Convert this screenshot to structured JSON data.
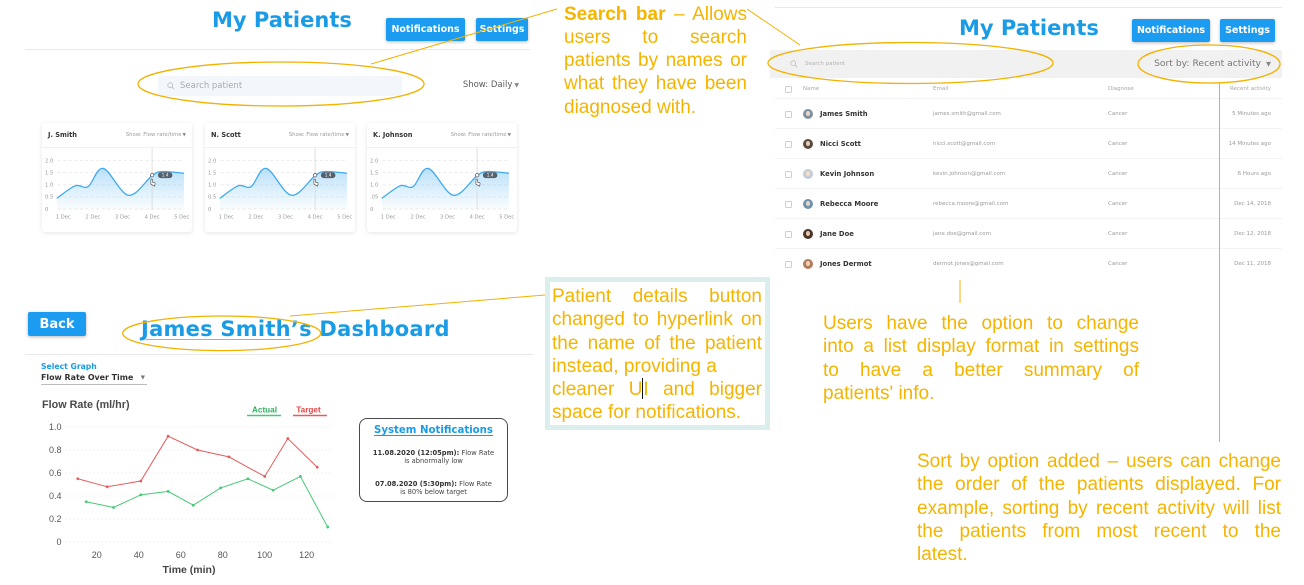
{
  "colors": {
    "primary": "#1a9be6",
    "button": "#1c9cf0",
    "annotation": "#f5b400",
    "mini_line": "#3fa9f0",
    "mini_area": "#8fcdf6",
    "actual": "#46c878",
    "target": "#e35d5d"
  },
  "grid_view": {
    "title": "My Patients",
    "buttons": {
      "notifications": "Notifications",
      "settings": "Settings"
    },
    "search": {
      "placeholder": "Search patient"
    },
    "show_filter": {
      "label": "Show: Daily"
    },
    "cards": [
      {
        "name": "J. Smith",
        "metric_select": "Show: Flow rate/time"
      },
      {
        "name": "N. Scott",
        "metric_select": "Show: Flow rate/time"
      },
      {
        "name": "K. Johnson",
        "metric_select": "Show: Flow rate/time"
      }
    ]
  },
  "list_view": {
    "title": "My Patients",
    "buttons": {
      "notifications": "Notifications",
      "settings": "Settings"
    },
    "search": {
      "placeholder": "Search patient"
    },
    "sort": {
      "label": "Sort by: Recent activity"
    },
    "columns": {
      "name": "Name",
      "email": "Email",
      "diagnose": "Diagnose",
      "activity": "Recent activity"
    },
    "rows": [
      {
        "name": "James Smith",
        "email": "james.smith@gmail.com",
        "diagnose": "Cancer",
        "activity": "5 Minutes ago",
        "avatar_color": "#7f92a3"
      },
      {
        "name": "Nicci Scott",
        "email": "nicci.scott@gmail.com",
        "diagnose": "Cancer",
        "activity": "14 Minutes ago",
        "avatar_color": "#5b4b3e"
      },
      {
        "name": "Kevin Johnson",
        "email": "kevin.johnson@gmail.com",
        "diagnose": "Cancer",
        "activity": "6 Hours ago",
        "avatar_color": "#c3ccd4"
      },
      {
        "name": "Rebecca Moore",
        "email": "rebecca.moore@gmail.com",
        "diagnose": "Cancer",
        "activity": "Dec 14, 2018",
        "avatar_color": "#6f93ab"
      },
      {
        "name": "Jane Doe",
        "email": "jane.doe@gmail.com",
        "diagnose": "Cancer",
        "activity": "Dec 12, 2018",
        "avatar_color": "#4b3426"
      },
      {
        "name": "Jones Dermot",
        "email": "dermot.jones@gmail.com",
        "diagnose": "Cancer",
        "activity": "Dec 11, 2018",
        "avatar_color": "#b27c5c"
      }
    ]
  },
  "dashboard": {
    "back": "Back",
    "patient_name": "James Smith",
    "possessive": "’s",
    "title_suffix": "Dashboard",
    "select_graph_label": "Select Graph",
    "graph_value": "Flow Rate Over Time",
    "notifications": {
      "title": "System Notifications",
      "items": [
        {
          "time": "11.08.2020 (12:05pm):",
          "message": [
            "Flow Rate",
            "is abnormally low"
          ]
        },
        {
          "time": "07.08.2020 (5:30pm):",
          "message": [
            "Flow Rate",
            "is 80% below target"
          ]
        }
      ]
    }
  },
  "annotations": {
    "search_bar": {
      "title": "Search bar",
      "first_line_rest": " – Allows",
      "lines": [
        "users to search",
        "patients by names or",
        "what they have been",
        "diagnosed with."
      ]
    },
    "patient_details": {
      "lines": [
        "Patient details button",
        "changed to hyperlink on",
        "the name of the patient",
        "instead, providing a"
      ],
      "caret_line_before": "cleaner U",
      "caret_line_after": "I and bigger",
      "last_line": "space for notifications."
    },
    "list_display": {
      "lines": [
        "Users have the option to change",
        "into a list display format in settings",
        "to have a better summary of",
        "patients' info."
      ]
    },
    "sort_by": {
      "lines": [
        "Sort by option added – users can change",
        "the order of the patients displayed. For",
        "example, sorting by recent activity will list",
        "the patients from most recent to the",
        "latest."
      ]
    }
  },
  "chart_data": [
    {
      "id": "j-smith-mini",
      "type": "area",
      "title": "J. Smith",
      "x_ticks": [
        "1 Dec",
        "2 Dec",
        "3 Dec",
        "4 Dec",
        "5 Dec"
      ],
      "y_ticks": [
        {
          "value": 2.0,
          "label": "2.0"
        },
        {
          "value": 1.5,
          "label": "1.5"
        },
        {
          "value": 1.0,
          "label": "1.0"
        },
        {
          "value": 0.5,
          "label": "0.5"
        },
        {
          "value": 0,
          "label": "0"
        }
      ],
      "ylim": [
        0,
        2
      ],
      "grid": true,
      "points": [
        [
          0.78,
          0.44
        ],
        [
          1.4,
          0.96
        ],
        [
          1.84,
          0.93
        ],
        [
          2.35,
          1.68
        ],
        [
          3.2,
          0.57
        ],
        [
          4.0,
          1.38
        ],
        [
          4.35,
          1.55
        ],
        [
          5.08,
          1.48
        ]
      ],
      "highlight": {
        "x": 4,
        "value": 1.4,
        "label": "1.4"
      }
    },
    {
      "id": "n-scott-mini",
      "type": "area",
      "title": "N. Scott",
      "x_ticks": [
        "1 Dec",
        "2 Dec",
        "3 Dec",
        "4 Dec",
        "5 Dec"
      ],
      "y_ticks": [
        {
          "value": 2.0,
          "label": "2.0"
        },
        {
          "value": 1.5,
          "label": "1.5"
        },
        {
          "value": 1.0,
          "label": "1.0"
        },
        {
          "value": 0.5,
          "label": "0.5"
        },
        {
          "value": 0,
          "label": "0"
        }
      ],
      "ylim": [
        0,
        2
      ],
      "grid": true,
      "points": [
        [
          0.78,
          0.44
        ],
        [
          1.4,
          0.96
        ],
        [
          1.84,
          0.93
        ],
        [
          2.35,
          1.68
        ],
        [
          3.2,
          0.57
        ],
        [
          4.0,
          1.38
        ],
        [
          4.35,
          1.55
        ],
        [
          5.08,
          1.48
        ]
      ],
      "highlight": {
        "x": 4,
        "value": 1.4,
        "label": "1.4"
      }
    },
    {
      "id": "k-johnson-mini",
      "type": "area",
      "title": "K. Johnson",
      "x_ticks": [
        "1 Dec",
        "2 Dec",
        "3 Dec",
        "4 Dec",
        "5 Dec"
      ],
      "y_ticks": [
        {
          "value": 2.0,
          "label": "2.0"
        },
        {
          "value": 1.5,
          "label": "1.5"
        },
        {
          "value": 1.0,
          "label": "1.0"
        },
        {
          "value": 0.5,
          "label": ".05"
        },
        {
          "value": 0,
          "label": "0"
        }
      ],
      "ylim": [
        0,
        2
      ],
      "grid": true,
      "points": [
        [
          0.78,
          0.44
        ],
        [
          1.4,
          0.96
        ],
        [
          1.84,
          0.93
        ],
        [
          2.35,
          1.68
        ],
        [
          3.2,
          0.57
        ],
        [
          4.0,
          1.38
        ],
        [
          4.35,
          1.55
        ],
        [
          5.08,
          1.48
        ]
      ],
      "highlight": {
        "x": 4,
        "value": 1.4,
        "label": "1.4"
      }
    },
    {
      "id": "flow-rate-over-time",
      "type": "line",
      "title": "Flow Rate (ml/hr)",
      "xlabel": "Time (min)",
      "ylabel": "Flow Rate (ml/hr)",
      "x_ticks": [
        20,
        40,
        60,
        80,
        100,
        120
      ],
      "x_tick_labels": [
        "20",
        "40",
        "60",
        "80",
        "100",
        "120"
      ],
      "y_ticks": [
        1.0,
        0.8,
        0.6,
        0.4,
        0.2,
        0
      ],
      "y_tick_labels": [
        "1.0",
        "0.8",
        "0.6",
        "0.4",
        "0.2",
        "0"
      ],
      "ylim": [
        0,
        1.0
      ],
      "grid": true,
      "legend": "top-right",
      "series": [
        {
          "name": "Actual",
          "color": "#46c878",
          "label_color": "#2eaf5e",
          "points": [
            [
              15,
              0.35
            ],
            [
              28,
              0.3
            ],
            [
              41,
              0.41
            ],
            [
              54,
              0.44
            ],
            [
              66,
              0.32
            ],
            [
              79,
              0.47
            ],
            [
              92,
              0.55
            ],
            [
              104,
              0.45
            ],
            [
              117,
              0.57
            ],
            [
              130,
              0.13
            ]
          ]
        },
        {
          "name": "Target",
          "color": "#e35d5d",
          "label_color": "#e04848",
          "points": [
            [
              11,
              0.55
            ],
            [
              25,
              0.48
            ],
            [
              41,
              0.53
            ],
            [
              54,
              0.92
            ],
            [
              68,
              0.8
            ],
            [
              83,
              0.74
            ],
            [
              100,
              0.57
            ],
            [
              111,
              0.9
            ],
            [
              125,
              0.65
            ]
          ]
        }
      ]
    }
  ]
}
